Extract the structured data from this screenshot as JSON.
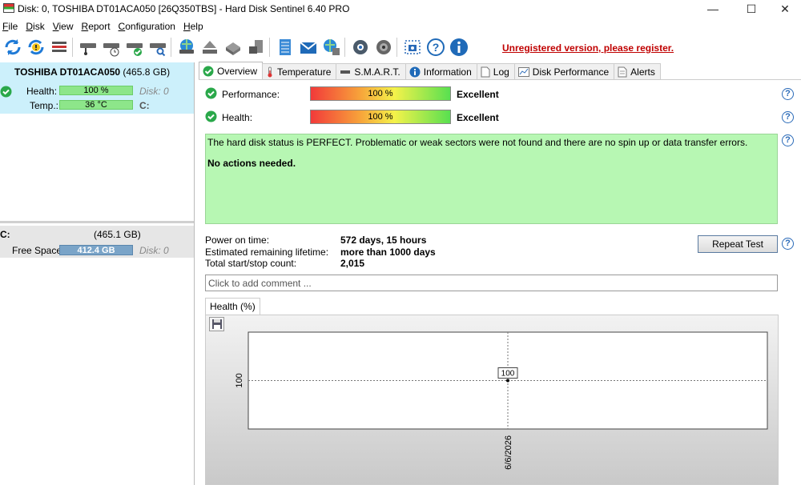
{
  "window": {
    "title": "Disk: 0, TOSHIBA DT01ACA050 [26Q350TBS]  -  Hard Disk Sentinel 6.40 PRO",
    "minimize": "—",
    "maximize": "☐",
    "close": "✕"
  },
  "menu": {
    "items": [
      {
        "key": "F",
        "rest": "ile"
      },
      {
        "key": "D",
        "rest": "isk"
      },
      {
        "key": "V",
        "rest": "iew"
      },
      {
        "key": "R",
        "rest": "eport"
      },
      {
        "key": "C",
        "rest": "onfiguration"
      },
      {
        "key": "H",
        "rest": "elp"
      }
    ]
  },
  "toolbar": {
    "register_notice": "Unregistered version, please register.",
    "icons": [
      "refresh-icon",
      "refresh-warning-icon",
      "disk-list-icon",
      "disk-drive-icon",
      "disk-schedule-icon",
      "disk-check-icon",
      "disk-search-icon",
      "globe-disk-icon",
      "eject-icon",
      "usb-drive-icon",
      "server-disk-icon",
      "notepad-icon",
      "mail-icon",
      "network-globe-icon",
      "gear-icon",
      "sound-icon",
      "screenshot-icon",
      "help-icon",
      "info-icon"
    ]
  },
  "left_panel": {
    "disk": {
      "name": "TOSHIBA DT01ACA050",
      "size": "(465.8 GB)",
      "health_label": "Health:",
      "health_value": "100 %",
      "health_fraction": 1.0,
      "temp_label": "Temp.:",
      "temp_value": "36 °C",
      "disk_index": "Disk: 0",
      "drive_letter": "C:"
    },
    "volume": {
      "letter": "C:",
      "size": "(465.1 GB)",
      "free_label": "Free Space",
      "free_value": "412.4 GB",
      "disk_index": "Disk: 0"
    }
  },
  "tabs": [
    {
      "label": "Overview",
      "active": true
    },
    {
      "label": "Temperature",
      "active": false
    },
    {
      "label": "S.M.A.R.T.",
      "active": false
    },
    {
      "label": "Information",
      "active": false
    },
    {
      "label": "Log",
      "active": false
    },
    {
      "label": "Disk Performance",
      "active": false
    },
    {
      "label": "Alerts",
      "active": false
    }
  ],
  "overview": {
    "performance_label": "Performance:",
    "performance_value": "100 %",
    "performance_fraction": 1.0,
    "performance_rating": "Excellent",
    "health_label": "Health:",
    "health_value": "100 %",
    "health_fraction": 1.0,
    "health_rating": "Excellent",
    "status_message": "The hard disk status is PERFECT. Problematic or weak sectors were not found and there are no spin up or data transfer errors.",
    "status_action": "No actions needed.",
    "power_on_label": "Power on time:",
    "power_on_value": "572 days, 15 hours",
    "lifetime_label": "Estimated remaining lifetime:",
    "lifetime_value": "more than 1000 days",
    "startstop_label": "Total start/stop count:",
    "startstop_value": "2,015",
    "repeat_test": "Repeat Test",
    "comment_placeholder": "Click to add comment ...",
    "help_glyph": "?"
  },
  "health_chart": {
    "tab_label": "Health (%)",
    "colors": {
      "status_green": "#b7f7b3",
      "register_red": "#c00000",
      "selected_disk": "#ccf0fb"
    }
  },
  "chart_data": {
    "type": "line",
    "x": [
      "6/6/2026"
    ],
    "values": [
      100
    ],
    "ytick_labels": [
      "100"
    ],
    "data_labels": [
      "100"
    ],
    "grid": true
  }
}
